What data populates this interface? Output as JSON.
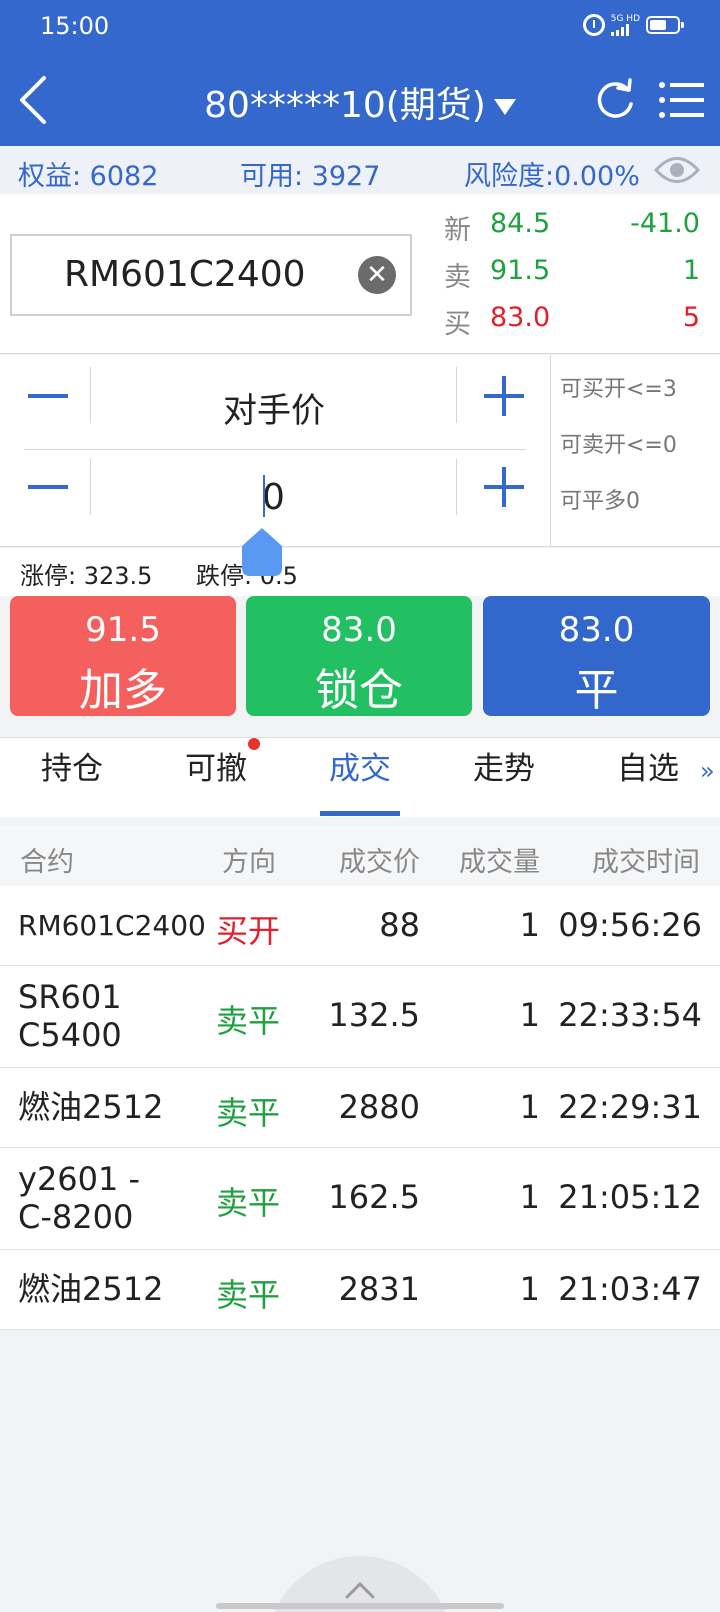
{
  "status_bar": {
    "time": "15:00",
    "network": "5G HD"
  },
  "header": {
    "account": "80*****10(期货)"
  },
  "account_bar": {
    "equity": "权益: 6082",
    "available": "可用: 3927",
    "risk": "风险度:0.00%"
  },
  "contract": {
    "code": "RM601C2400"
  },
  "quote": [
    {
      "label": "新",
      "price": "84.5",
      "value": "-41.0"
    },
    {
      "label": "卖",
      "price": "91.5",
      "value": "1"
    },
    {
      "label": "买",
      "price": "83.0",
      "value": "5"
    }
  ],
  "order": {
    "price_type": "对手价",
    "quantity": "0"
  },
  "limits": {
    "can_buy_open": "可买开<=3",
    "can_sell_open": "可卖开<=0",
    "can_close_long": "可平多0"
  },
  "limit_line": {
    "up": "涨停: 323.5",
    "down": "跌停: 0.5"
  },
  "actions": [
    {
      "price": "91.5",
      "label": "加多",
      "color": "#f4605e"
    },
    {
      "price": "83.0",
      "label": "锁仓",
      "color": "#23c063"
    },
    {
      "price": "83.0",
      "label": "平",
      "color": "#3268cc"
    }
  ],
  "tabs": [
    {
      "label": "持仓"
    },
    {
      "label": "可撤"
    },
    {
      "label": "成交"
    },
    {
      "label": "走势"
    },
    {
      "label": "自选"
    }
  ],
  "active_tab": "成交",
  "more": "»",
  "trades_table": {
    "headers": [
      "合约",
      "方向",
      "成交价",
      "成交量",
      "成交时间"
    ],
    "rows": [
      {
        "contract": "RM601C2400",
        "direction": "买开",
        "price": "88",
        "qty": "1",
        "time": "09:56:26"
      },
      {
        "contract": "SR601 C5400",
        "direction": "卖平",
        "price": "132.5",
        "qty": "1",
        "time": "22:33:54"
      },
      {
        "contract": "燃油2512",
        "direction": "卖平",
        "price": "2880",
        "qty": "1",
        "time": "22:29:31"
      },
      {
        "contract": "y2601 -C-8200",
        "direction": "卖平",
        "price": "162.5",
        "qty": "1",
        "time": "21:05:12"
      },
      {
        "contract": "燃油2512",
        "direction": "卖平",
        "price": "2831",
        "qty": "1",
        "time": "21:03:47"
      }
    ]
  },
  "colors": {
    "brand": "#3468cc",
    "up": "#e0202a",
    "down": "#21a040"
  }
}
